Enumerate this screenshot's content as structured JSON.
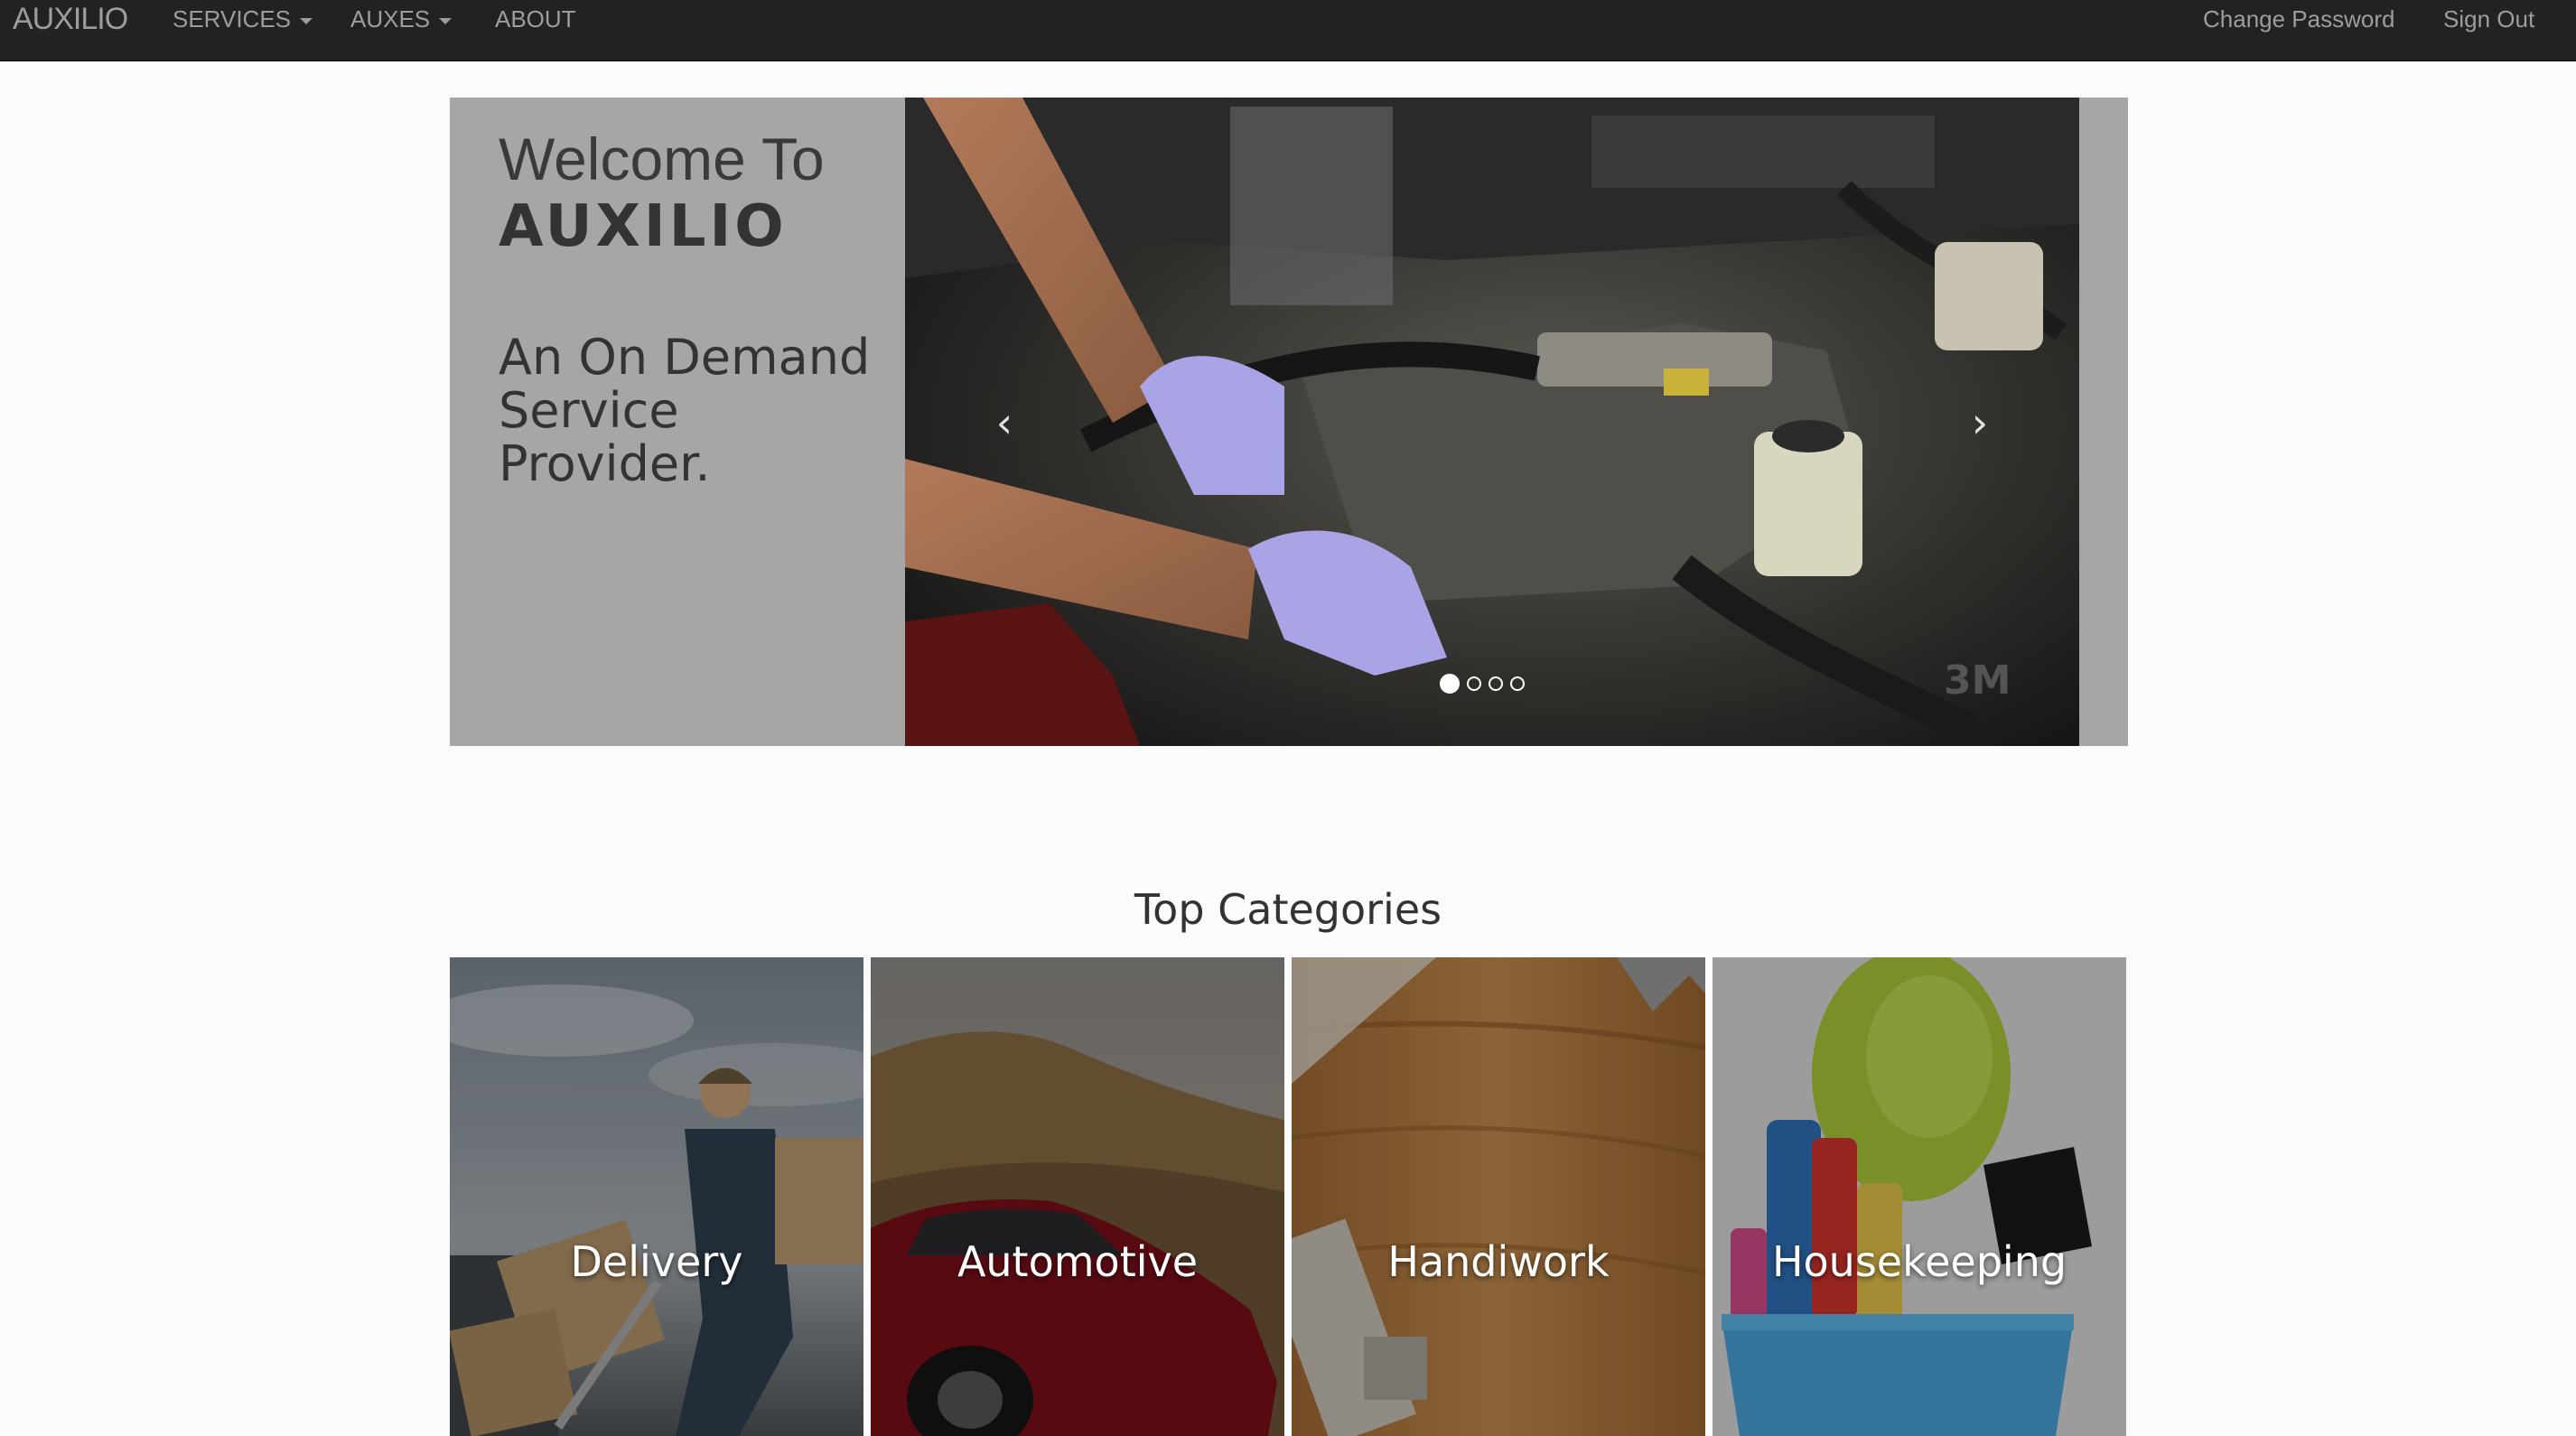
{
  "navbar": {
    "brand": "AUXILIO",
    "menu": [
      {
        "label": "SERVICES",
        "dropdown": true
      },
      {
        "label": "AUXES",
        "dropdown": true
      },
      {
        "label": "ABOUT",
        "dropdown": false
      }
    ],
    "right": [
      {
        "label": "Change Password"
      },
      {
        "label": "Sign Out"
      }
    ]
  },
  "hero": {
    "welcome": "Welcome To",
    "logo": "AUXILIO",
    "tagline": "An On Demand Service Provider.",
    "carousel": {
      "slide_count": 4,
      "active_slide": 1,
      "prev_icon": "chevron-left-icon",
      "next_icon": "chevron-right-icon",
      "watermark": "3M"
    }
  },
  "categories": {
    "title": "Top Categories",
    "items": [
      {
        "label": "Delivery"
      },
      {
        "label": "Automotive"
      },
      {
        "label": "Handiwork"
      },
      {
        "label": "Housekeeping"
      }
    ]
  },
  "colors": {
    "navbar_bg": "#222222",
    "nav_text": "#9d9d9d",
    "hero_panel": "#a6a6a6",
    "page_bg": "#fbfbfb"
  }
}
